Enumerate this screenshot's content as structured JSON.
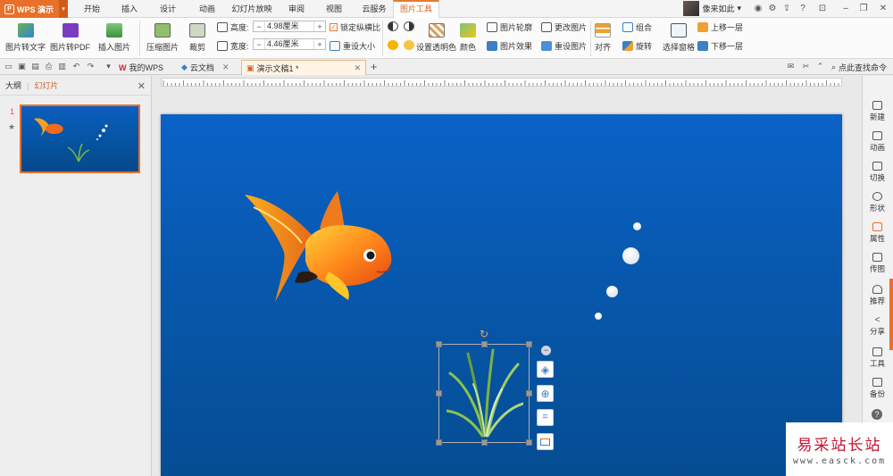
{
  "app": {
    "name": "WPS 演示"
  },
  "menu": {
    "tabs": [
      "开始",
      "插入",
      "设计",
      "动画",
      "幻灯片放映",
      "审阅",
      "视图",
      "云服务",
      "图片工具"
    ],
    "active_tab": "图片工具"
  },
  "user": {
    "name": "像来如此"
  },
  "ribbon": {
    "pic_to_text": "图片转文字",
    "pic_to_pdf": "图片转PDF",
    "insert_pic": "插入图片",
    "compress_pic": "压缩图片",
    "crop": "裁剪",
    "height_label": "高度:",
    "height_value": "4.98厘米",
    "width_label": "宽度:",
    "width_value": "4.46厘米",
    "lock_ratio": "锁定纵横比",
    "reset_size": "重设大小",
    "set_transparent": "设置透明色",
    "color": "颜色",
    "pic_outline": "图片轮廓",
    "pic_effect": "图片效果",
    "change_pic": "更改图片",
    "reset_pic": "重设图片",
    "align": "对齐",
    "group": "组合",
    "rotate": "旋转",
    "select_pane": "选择窗格",
    "bring_forward": "上移一层",
    "send_backward": "下移一层"
  },
  "tabs_row": {
    "my_wps": "我的WPS",
    "cloud_docs": "云文档",
    "document": "演示文稿1 *",
    "add": "+",
    "search": "点此查找命令"
  },
  "left_panel": {
    "tab_outline": "大纲",
    "tab_slides": "幻灯片",
    "slide_number": "1"
  },
  "right_bar": {
    "items": [
      "新建",
      "动画",
      "切换",
      "形状",
      "属性",
      "传图",
      "推荐",
      "分享",
      "工具",
      "备份"
    ]
  },
  "watermark": {
    "title": "易采站长站",
    "url": "www.easck.com"
  },
  "colors": {
    "accent": "#e8702a",
    "slide_top": "#0b62c7",
    "slide_bottom": "#064d93"
  }
}
